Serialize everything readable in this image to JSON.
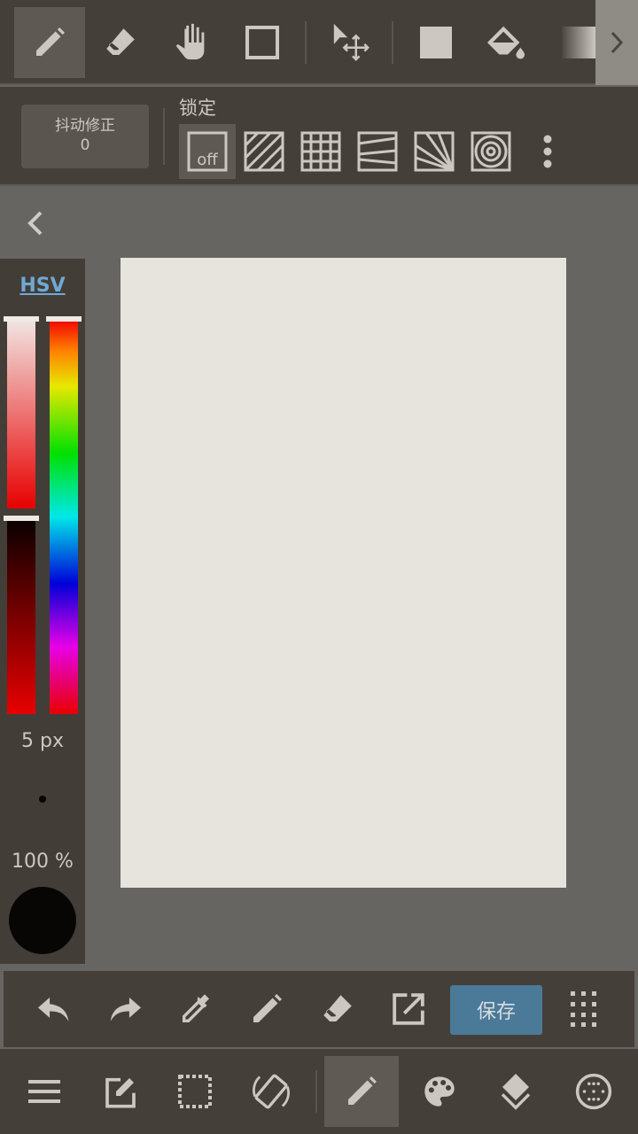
{
  "top_toolbar": {
    "tools": [
      "brush",
      "eraser",
      "hand",
      "rectangle",
      "select-move",
      "fill-color",
      "bucket",
      "gradient"
    ],
    "selected": "brush",
    "more_icon": "chevron-right-icon"
  },
  "sub_toolbar": {
    "stabilizer_label": "抖动修正",
    "stabilizer_value": "0",
    "lock_label": "锁定",
    "lock_options": [
      "off",
      "parallel",
      "grid",
      "perspective",
      "radial",
      "concentric"
    ],
    "lock_off_text": "off",
    "selected_lock": "off"
  },
  "color_panel": {
    "mode": "HSV",
    "brush_size": "5 px",
    "opacity": "100 %",
    "current_color": "#080604",
    "hue_color": "#e80000"
  },
  "action_bar": {
    "save_label": "保存",
    "save_color": "#4b7a99"
  },
  "bottom_nav": {
    "items": [
      "menu",
      "edit",
      "selection",
      "rotate",
      "brush",
      "palette",
      "layers",
      "material"
    ],
    "selected": "brush"
  }
}
